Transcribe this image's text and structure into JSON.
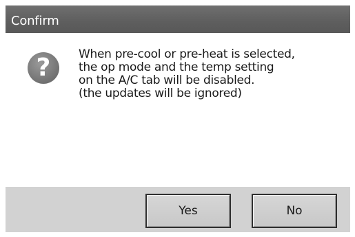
{
  "dialog": {
    "title": "Confirm",
    "icon": "question-icon",
    "icon_glyph": "?",
    "message_lines": [
      "When pre-cool or pre-heat is selected,",
      "the op mode and the temp setting",
      "on the A/C tab will be disabled.",
      "(the updates will be ignored)"
    ],
    "buttons": {
      "yes_label": "Yes",
      "no_label": "No"
    }
  },
  "colors": {
    "titlebar": "#5e5e5e",
    "footer": "#d2d2d2",
    "frame": "#2b2b2b"
  }
}
